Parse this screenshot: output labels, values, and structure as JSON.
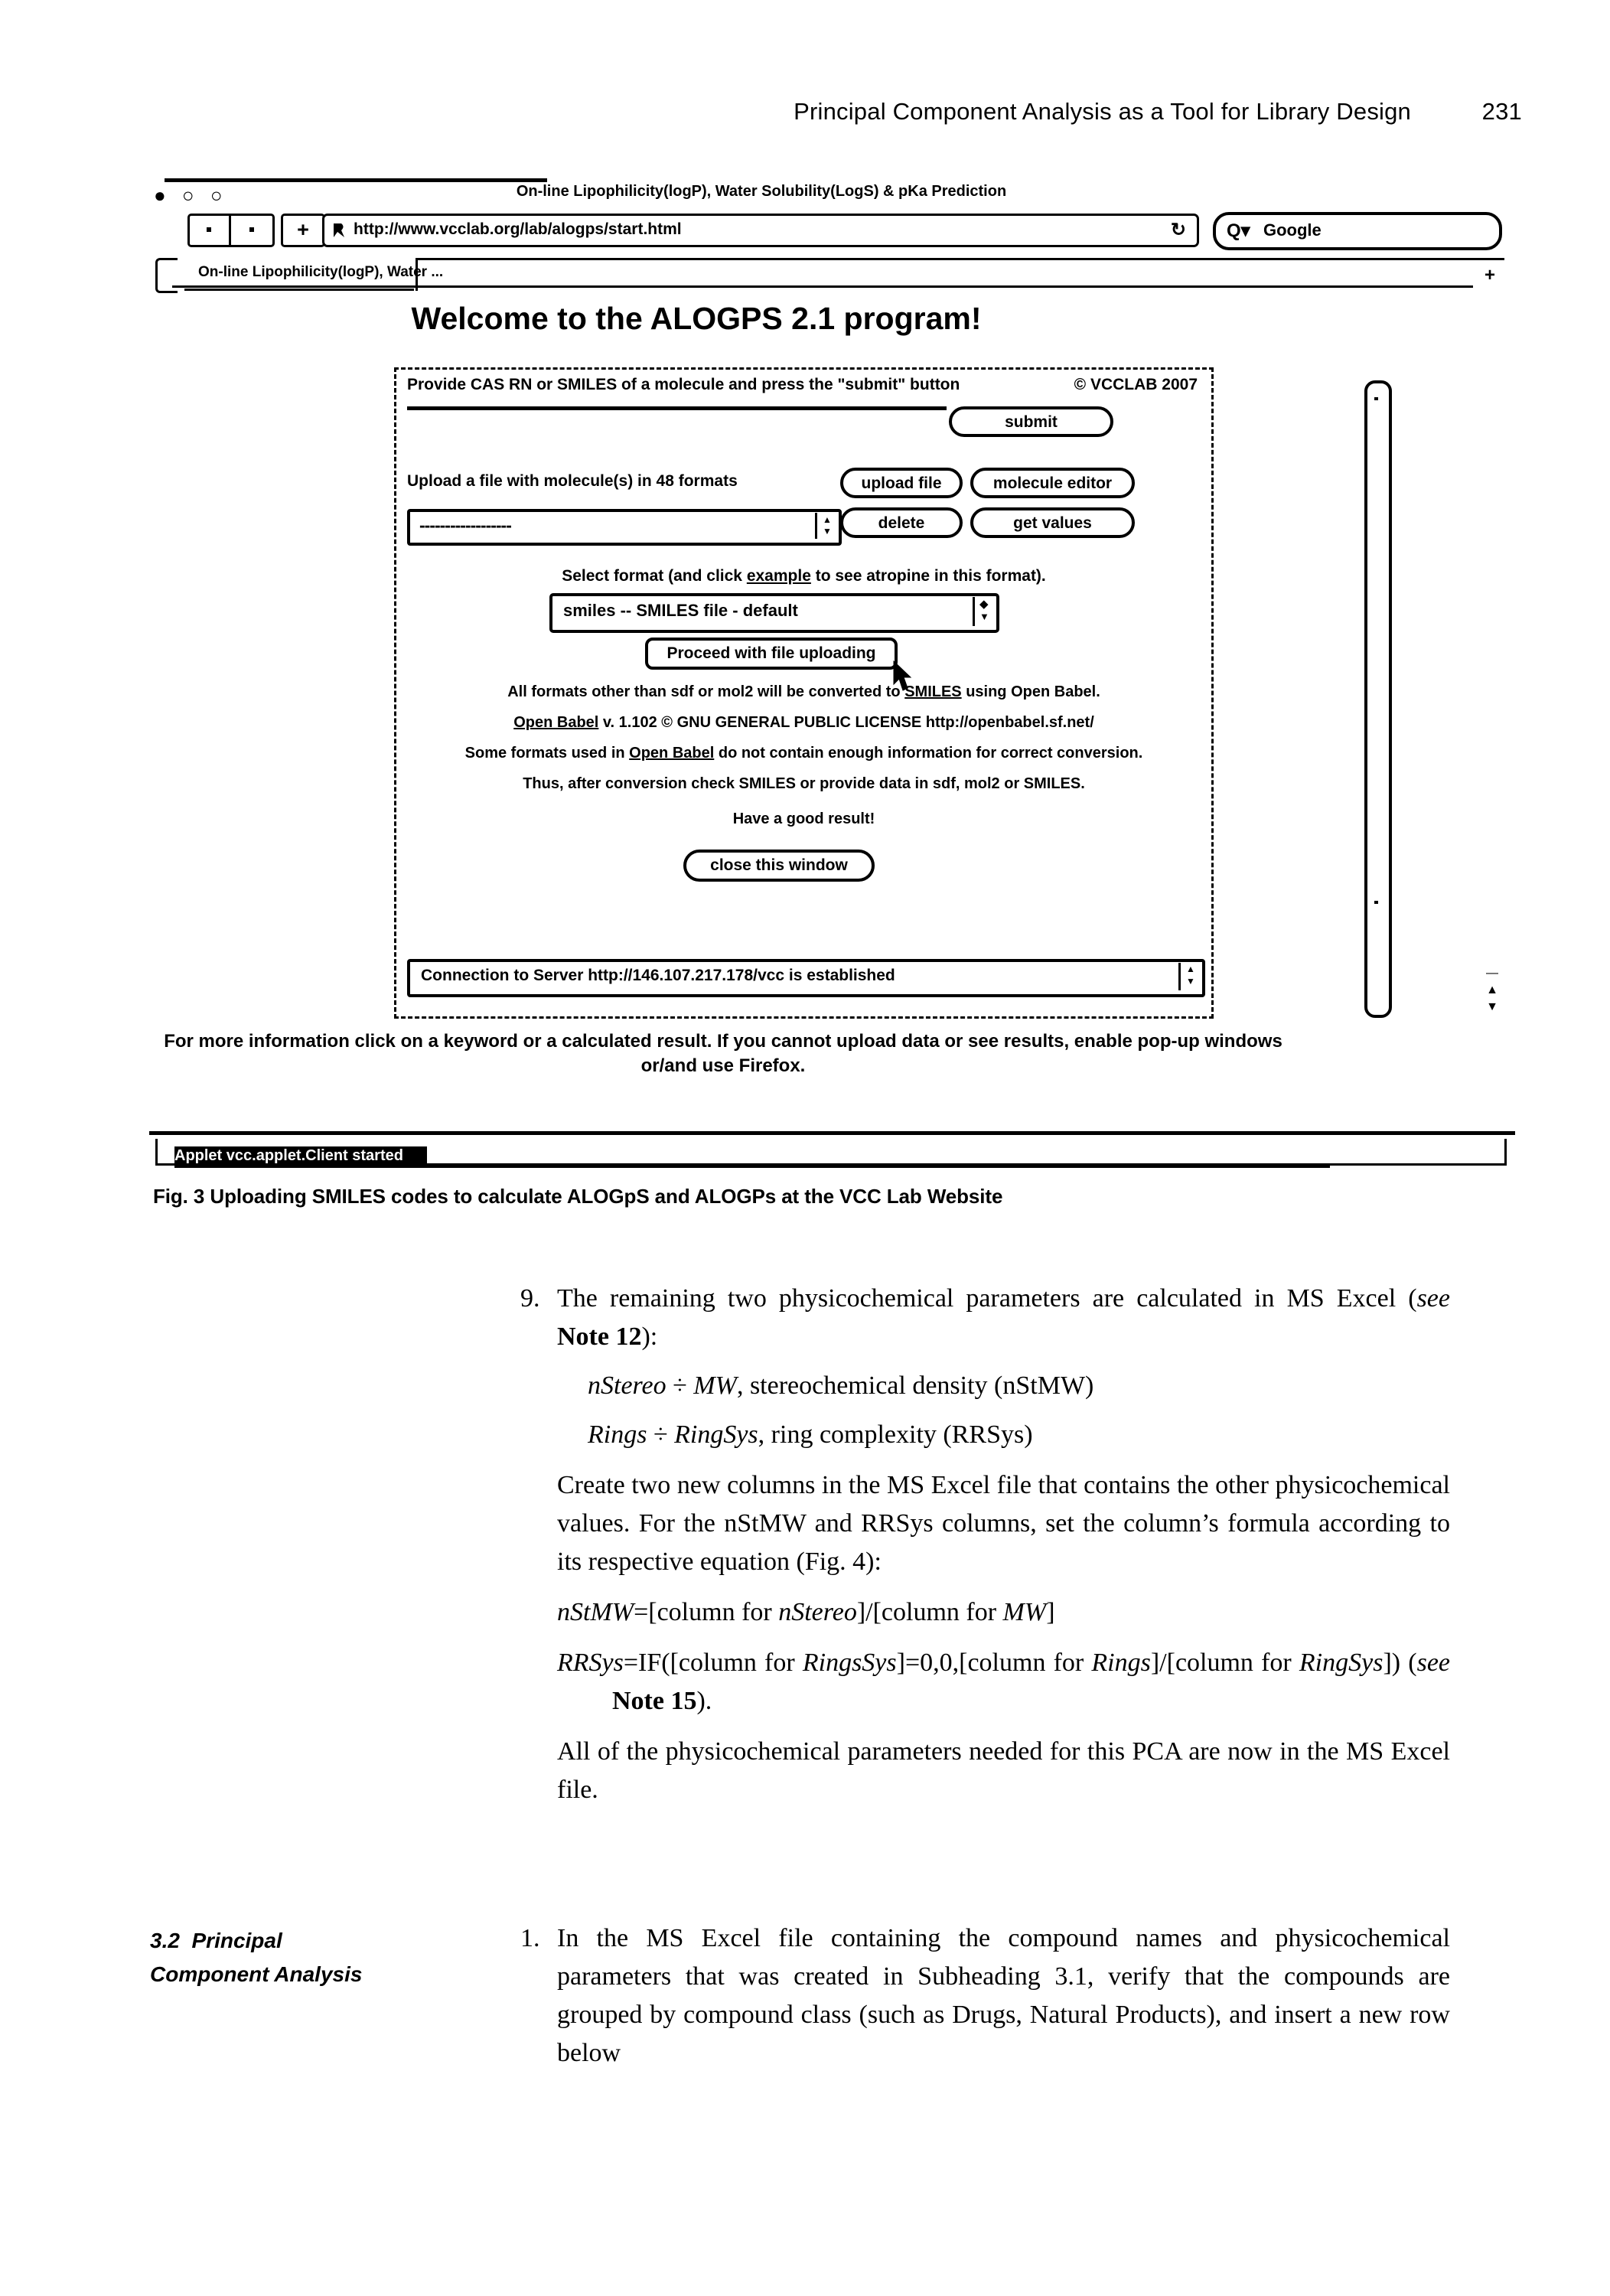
{
  "running_head": {
    "title": "Principal Component Analysis as a Tool for Library Design",
    "page_number": "231"
  },
  "figure": {
    "browser": {
      "window_title": "On-line Lipophilicity(logP), Water Solubility(LogS) & pKa Prediction",
      "traffic_lights": "● ○ ○",
      "nav_back_label": "‹",
      "nav_forward_label": "›",
      "add_tab_label": "+",
      "url": "http://www.vcclab.org/lab/alogps/start.html",
      "reload_label": "↻",
      "search_engine_label": "Google",
      "search_icon_label": "Q▾",
      "tab_label": "On-line Lipophilicity(logP), Water ...",
      "new_tab_plus": "+"
    },
    "page": {
      "heading": "Welcome to the ALOGPS 2.1 program!",
      "applet": {
        "prompt": "Provide CAS RN or SMILES of a molecule and press the \"submit\" button",
        "copyright": "© VCCLAB 2007",
        "smiles_input_value": "",
        "upload_label": "Upload a file with molecule(s) in 48 formats",
        "file_field_value": "------------------",
        "buttons": {
          "submit": "submit",
          "upload_file": "upload file",
          "molecule_editor": "molecule editor",
          "delete": "delete",
          "get_values": "get values",
          "proceed": "Proceed with file uploading",
          "close_window": "close this window"
        },
        "select_format_pre": "Select format (and click ",
        "select_format_link": "example",
        "select_format_post": " to see atropine in this format).",
        "format_selected": "smiles -- SMILES file - default",
        "notes": [
          "All formats other than sdf or mol2 will be converted to SMILES using Open Babel.",
          "Open Babel v. 1.102 © GNU GENERAL PUBLIC LICENSE http://openbabel.sf.net/",
          "Some formats used in Open Babel do not contain enough information for correct conversion.",
          "Thus, after conversion check SMILES or provide data in sdf, mol2 or SMILES.",
          "Have a good result!"
        ],
        "connection_status": "Connection to Server http://146.107.217.178/vcc is established"
      },
      "footer_note": "For more information click on a keyword or a calculated result. If you cannot upload data or see results, enable pop-up windows or/and use Firefox.",
      "window_status": "Applet vcc.applet.Client started"
    },
    "caption": {
      "label": "Fig. 3",
      "text": " Uploading SMILES codes to calculate ALOGpS and ALOGPs at the VCC Lab Website"
    }
  },
  "body": {
    "step9": {
      "number": "9.",
      "line1_a": "The remaining two physicochemical parameters are calculated in MS Excel (",
      "line1_see": "see",
      "line1_note": " Note 12",
      "line1_b": "):",
      "eq1_italic1": "nStereo",
      "eq1_div": " ÷ ",
      "eq1_italic2": "MW",
      "eq1_rest": ", stereochemical density (nStMW)",
      "eq2_italic1": "Rings",
      "eq2_div": " ÷ ",
      "eq2_italic2": "RingSys",
      "eq2_rest": ", ring complexity (RRSys)",
      "para": "Create two new columns in the MS Excel file that contains the other physicochemical values. For the nStMW and RRSys columns, set the column’s formula according to its respective equation (Fig. 4):",
      "formula1_a": "nStMW",
      "formula1_b": "=[column for ",
      "formula1_c": "nStereo",
      "formula1_d": "]/[column for ",
      "formula1_e": "MW",
      "formula1_f": "]",
      "formula2_a": "RRSys",
      "formula2_b": "=IF([column for ",
      "formula2_c": "RingsSys",
      "formula2_d": "]=0,0,[column for ",
      "formula2_e": "Rings",
      "formula2_f": "]/[column for ",
      "formula2_g": "RingSys",
      "formula2_h": "]) (",
      "formula2_see": "see",
      "formula2_note": " Note 15",
      "formula2_end": ").",
      "closing": "All of the physicochemical parameters needed for this PCA are now in the MS Excel file."
    },
    "section_3_2": {
      "number": "3.2",
      "title_line1": "Principal",
      "title_line2": "Component Analysis",
      "step1_number": "1.",
      "step1_text": "In the MS Excel file containing the compound names and physicochemical parameters that was created in Subheading 3.1, verify that the compounds are grouped by compound class (such as Drugs, Natural Products), and insert a new row below"
    }
  },
  "colors": {
    "ink": "#000000",
    "paper": "#ffffff"
  }
}
